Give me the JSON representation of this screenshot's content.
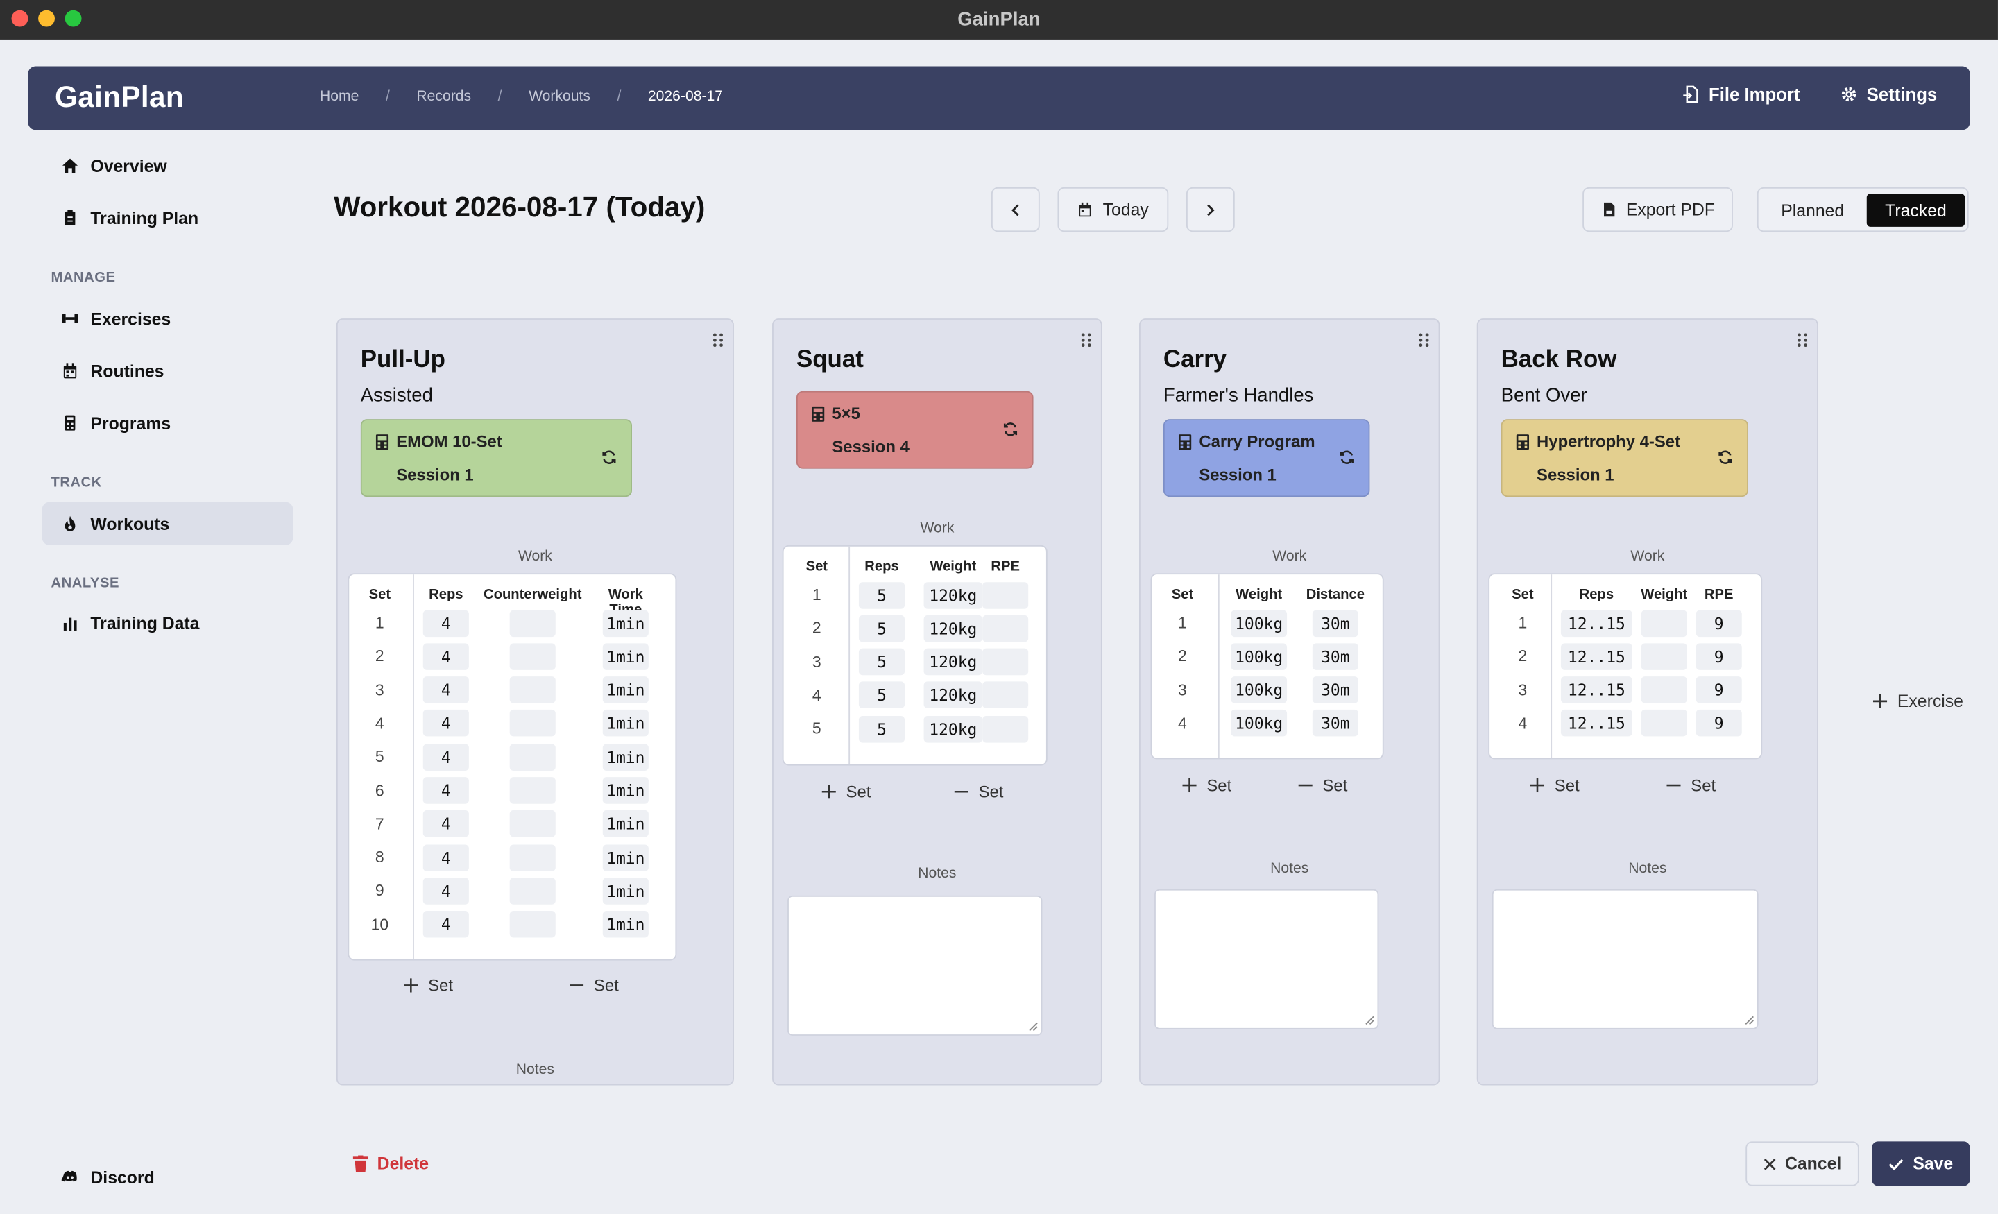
{
  "window": {
    "title": "GainPlan"
  },
  "header": {
    "logo": "GainPlan",
    "breadcrumb": [
      "Home",
      "Records",
      "Workouts",
      "2026-08-17"
    ],
    "file_import": "File Import",
    "settings": "Settings"
  },
  "sidebar": {
    "overview": "Overview",
    "training_plan": "Training Plan",
    "manage_heading": "MANAGE",
    "exercises": "Exercises",
    "routines": "Routines",
    "programs": "Programs",
    "track_heading": "TRACK",
    "workouts": "Workouts",
    "analyse_heading": "ANALYSE",
    "training_data": "Training Data",
    "discord": "Discord"
  },
  "page": {
    "title": "Workout 2026-08-17 (Today)",
    "today": "Today",
    "export_pdf": "Export PDF",
    "planned": "Planned",
    "tracked": "Tracked",
    "add_exercise": "Exercise",
    "delete": "Delete",
    "cancel": "Cancel",
    "save": "Save"
  },
  "labels": {
    "work": "Work",
    "notes": "Notes",
    "set": "Set"
  },
  "exercises": [
    {
      "name": "Pull-Up",
      "variant": "Assisted",
      "program": "EMOM 10-Set",
      "session": "Session 1",
      "color": "#b5d49a",
      "columns": [
        "Set",
        "Reps",
        "Counterweight",
        "Work Time"
      ],
      "rows": [
        [
          "1",
          "4",
          "",
          "1min"
        ],
        [
          "2",
          "4",
          "",
          "1min"
        ],
        [
          "3",
          "4",
          "",
          "1min"
        ],
        [
          "4",
          "4",
          "",
          "1min"
        ],
        [
          "5",
          "4",
          "",
          "1min"
        ],
        [
          "6",
          "4",
          "",
          "1min"
        ],
        [
          "7",
          "4",
          "",
          "1min"
        ],
        [
          "8",
          "4",
          "",
          "1min"
        ],
        [
          "9",
          "4",
          "",
          "1min"
        ],
        [
          "10",
          "4",
          "",
          "1min"
        ]
      ]
    },
    {
      "name": "Squat",
      "variant": "",
      "program": "5×5",
      "session": "Session 4",
      "color": "#d98a8a",
      "columns": [
        "Set",
        "Reps",
        "Weight",
        "RPE"
      ],
      "rows": [
        [
          "1",
          "5",
          "120kg",
          ""
        ],
        [
          "2",
          "5",
          "120kg",
          ""
        ],
        [
          "3",
          "5",
          "120kg",
          ""
        ],
        [
          "4",
          "5",
          "120kg",
          ""
        ],
        [
          "5",
          "5",
          "120kg",
          ""
        ]
      ]
    },
    {
      "name": "Carry",
      "variant": "Farmer's Handles",
      "program": "Carry Program",
      "session": "Session 1",
      "color": "#8fa3e3",
      "columns": [
        "Set",
        "Weight",
        "Distance"
      ],
      "rows": [
        [
          "1",
          "100kg",
          "30m"
        ],
        [
          "2",
          "100kg",
          "30m"
        ],
        [
          "3",
          "100kg",
          "30m"
        ],
        [
          "4",
          "100kg",
          "30m"
        ]
      ]
    },
    {
      "name": "Back Row",
      "variant": "Bent Over",
      "program": "Hypertrophy 4-Set",
      "session": "Session 1",
      "color": "#e3cf8f",
      "columns": [
        "Set",
        "Reps",
        "Weight",
        "RPE"
      ],
      "rows": [
        [
          "1",
          "12..15",
          "",
          "9"
        ],
        [
          "2",
          "12..15",
          "",
          "9"
        ],
        [
          "3",
          "12..15",
          "",
          "9"
        ],
        [
          "4",
          "12..15",
          "",
          "9"
        ]
      ]
    }
  ]
}
